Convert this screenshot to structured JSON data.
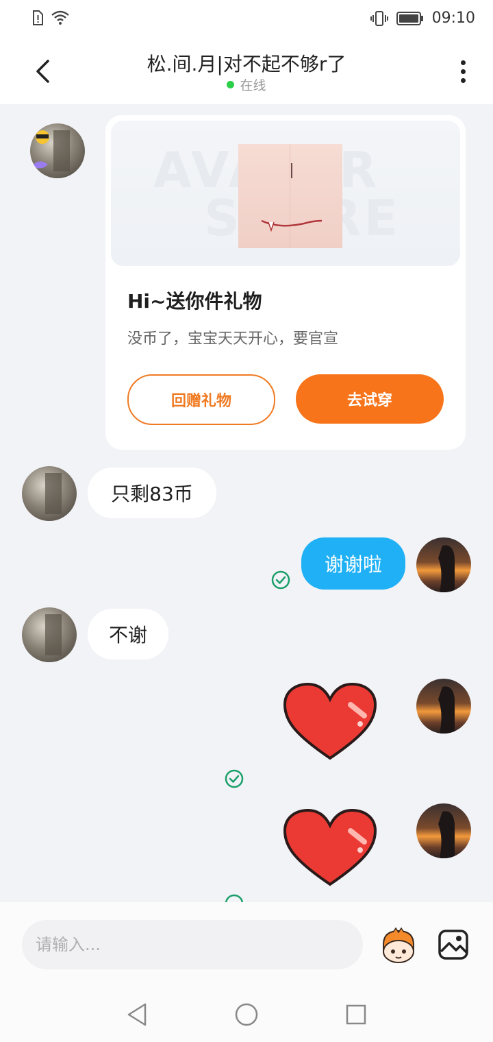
{
  "status_bar": {
    "time": "09:10"
  },
  "header": {
    "title": "松.间.月|对不起不够r了",
    "presence": "在线",
    "presence_color": "#2bcf4a"
  },
  "gift_card": {
    "watermark_line1": "AVATAR",
    "watermark_line2": "STORE",
    "title": "Hi~送你件礼物",
    "description": "没币了，宝宝天天开心，要官宣",
    "return_gift_label": "回赠礼物",
    "try_on_label": "去试穿",
    "accent_color": "#f7741a"
  },
  "messages": [
    {
      "direction": "incoming",
      "text": "只剩83币"
    },
    {
      "direction": "outgoing",
      "text": "谢谢啦",
      "status": "read"
    },
    {
      "direction": "incoming",
      "text": "不谢"
    },
    {
      "direction": "outgoing",
      "sticker": "heart-sticker",
      "status": "read"
    },
    {
      "direction": "outgoing",
      "sticker": "heart-sticker",
      "status": "read"
    }
  ],
  "composer": {
    "placeholder": "请输入..."
  },
  "icons": {
    "back": "chevron-left-icon",
    "more": "more-vertical-icon",
    "emoji": "emoji-mascot-icon",
    "image": "image-icon",
    "sent": "check-circle-icon"
  },
  "colors": {
    "outgoing_bubble": "#1fb0f5",
    "sent_check": "#1a9f6a"
  }
}
